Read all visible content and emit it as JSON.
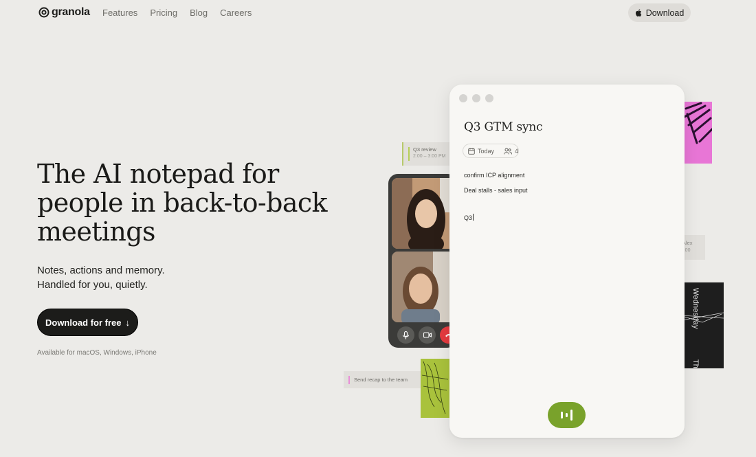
{
  "nav": {
    "brand": "granola",
    "links": [
      "Features",
      "Pricing",
      "Blog",
      "Careers"
    ],
    "download_label": "Download"
  },
  "hero": {
    "title": "The AI notepad for people in back-to-back meetings",
    "subtitle_line1": "Notes, actions and memory.",
    "subtitle_line2": "Handled for you, quietly.",
    "cta_label": "Download for free",
    "cta_arrow": "↓",
    "availability": "Available for macOS, Windows, iPhone"
  },
  "cards": {
    "q3review_title": "Q3 review",
    "q3review_time": "2:00 – 3:00 PM",
    "alex_title": "th Alex",
    "alex_time": "– 5:00",
    "recap": "Send recap to the team",
    "art_text_top": "Wednesday",
    "art_text_bottom": "Th"
  },
  "note": {
    "title": "Q3 GTM sync",
    "date": "Today",
    "attendees": "4",
    "lines": [
      "confirm ICP alignment",
      "Deal stalls - sales input",
      "Q3"
    ]
  },
  "colors": {
    "background": "#ecebe8",
    "cta": "#1c1c1a",
    "record": "#79a22b",
    "hangup": "#e53a3f",
    "pink_art": "#e876d6",
    "green_art": "#a9c23c"
  },
  "icons": [
    "granola-logo-icon",
    "apple-icon",
    "arrow-down-icon",
    "calendar-icon",
    "people-icon",
    "mic-icon",
    "camera-icon",
    "phone-icon",
    "waveform-icon"
  ]
}
